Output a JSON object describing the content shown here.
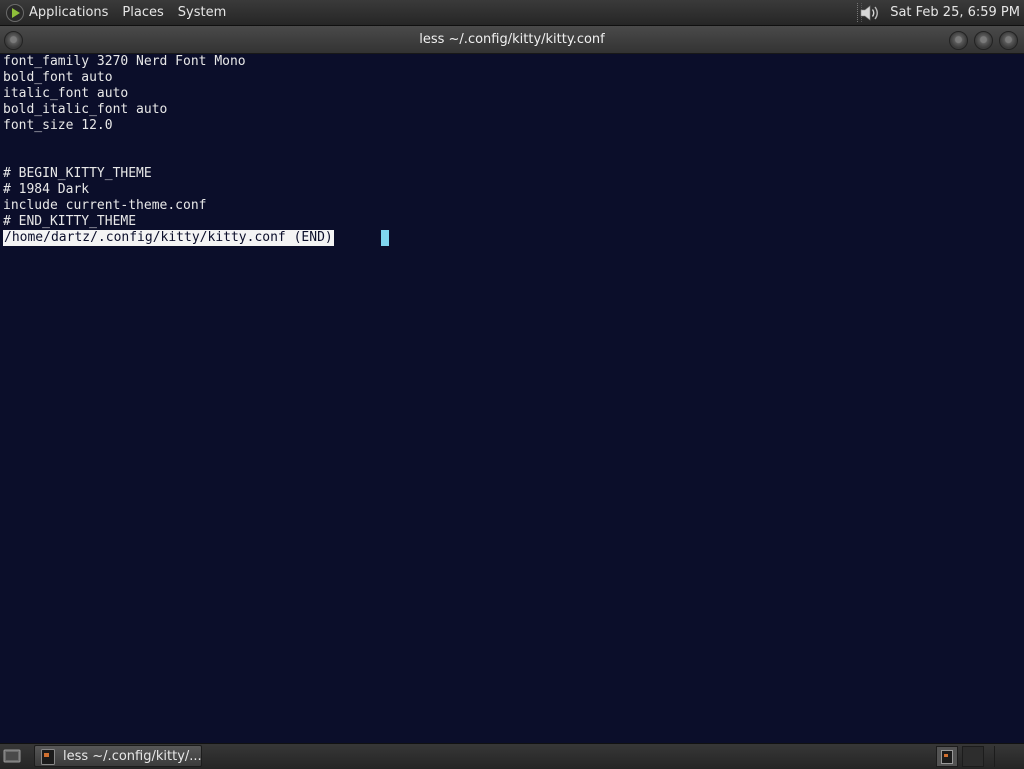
{
  "top_panel": {
    "menus": [
      "Applications",
      "Places",
      "System"
    ],
    "clock": "Sat Feb 25,  6:59 PM"
  },
  "window": {
    "title": "less ~/.config/kitty/kitty.conf"
  },
  "terminal": {
    "lines": [
      "font_family 3270 Nerd Font Mono",
      "bold_font auto",
      "italic_font auto",
      "bold_italic_font auto",
      "font_size 12.0",
      "",
      "",
      "# BEGIN_KITTY_THEME",
      "# 1984 Dark",
      "include current-theme.conf",
      "# END_KITTY_THEME"
    ],
    "status_line": "/home/dartz/.config/kitty/kitty.conf (END)"
  },
  "taskbar": {
    "task_label": "less ~/.config/kitty/..."
  },
  "icons": {
    "app_menu": "gnome-foot-icon",
    "volume": "speaker-icon",
    "window_menu": "window-menu-icon",
    "minimize": "minimize-icon",
    "maximize": "maximize-icon",
    "close": "close-icon",
    "show_desktop": "show-desktop-icon",
    "terminal": "terminal-icon"
  },
  "colors": {
    "terminal_bg": "#0b0e2a",
    "terminal_fg": "#e8e8e8",
    "cursor": "#7fd6ef",
    "panel": "#2e2e2e"
  }
}
